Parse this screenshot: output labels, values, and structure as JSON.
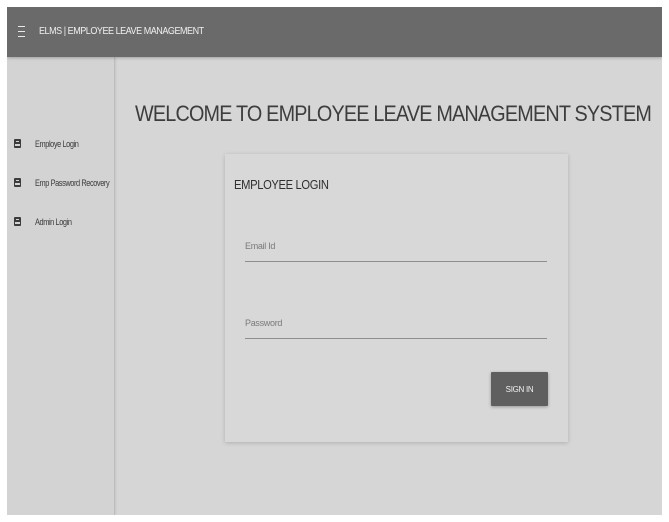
{
  "header": {
    "title": "ELMS | EMPLOYEE LEAVE MANAGEMENT",
    "menu_icon": "hamburger-menu-icon"
  },
  "sidebar": {
    "items": [
      {
        "label": "Employe Login",
        "icon": "account-box-icon"
      },
      {
        "label": "Emp Password Recovery",
        "icon": "account-box-icon"
      },
      {
        "label": "Admin Login",
        "icon": "account-box-icon"
      }
    ]
  },
  "main": {
    "title": "WELCOME TO EMPLOYEE LEAVE MANAGEMENT SYSTEM"
  },
  "login_card": {
    "title": "EMPLOYEE LOGIN",
    "email": {
      "placeholder": "Email Id",
      "value": ""
    },
    "password": {
      "placeholder": "Password",
      "value": ""
    },
    "submit_label": "SIGN IN"
  },
  "colors": {
    "topbar": "#6a6a6a",
    "page_background": "#d6d6d6",
    "button": "#5f5f5f"
  }
}
